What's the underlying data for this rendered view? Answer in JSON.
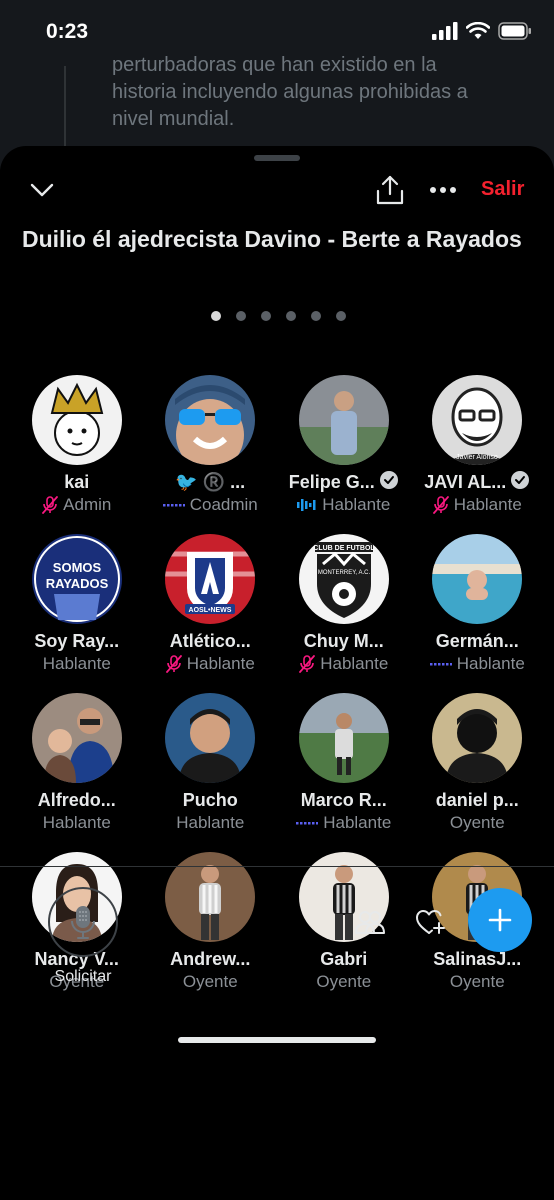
{
  "status": {
    "time": "0:23"
  },
  "background_tweet": {
    "line1": "perturbadoras que han existido en la",
    "line2": "historia incluyendo algunas prohibidas a",
    "line3": "nivel mundial."
  },
  "header": {
    "leave_label": "Salir"
  },
  "space": {
    "title": "Duilio él ajedrecista Davino - Berte a Rayados"
  },
  "pager": {
    "count": 6,
    "active": 0
  },
  "participants": [
    {
      "name": "kai",
      "role": "Admin",
      "status": "muted",
      "verified": false,
      "avatar": {
        "bg": "#f2f2f2",
        "fg": "#c9a227",
        "type": "crown"
      }
    },
    {
      "name": "🐦 ®️ ...",
      "role": "Coadmin",
      "status": "idle",
      "verified": false,
      "avatar": {
        "bg": "#d6a88a",
        "fg": "#1d9bf0",
        "type": "sunglasses"
      }
    },
    {
      "name": "Felipe G...",
      "role": "Hablante",
      "status": "speaking",
      "verified": true,
      "avatar": {
        "bg": "#5f7f5a",
        "fg": "#9bb2cf",
        "type": "stadium"
      }
    },
    {
      "name": "JAVI AL...",
      "role": "Hablante",
      "status": "muted",
      "verified": true,
      "avatar": {
        "bg": "#dcdcdc",
        "fg": "#222222",
        "type": "sketch",
        "caption": "Javier Alonso"
      }
    },
    {
      "name": "Soy Ray...",
      "role": "Hablante",
      "status": "none",
      "verified": false,
      "avatar": {
        "bg": "#1a2f7a",
        "fg": "#ffffff",
        "type": "text",
        "lines": [
          "SOMOS",
          "RAYADOS"
        ]
      }
    },
    {
      "name": "Atlético...",
      "role": "Hablante",
      "status": "muted",
      "verified": false,
      "avatar": {
        "bg": "#c8202c",
        "fg": "#ffffff",
        "type": "shield",
        "caption": "AOSL•NEWS"
      }
    },
    {
      "name": "Chuy M...",
      "role": "Hablante",
      "status": "muted",
      "verified": false,
      "avatar": {
        "bg": "#f4f4f4",
        "fg": "#1b1b1b",
        "type": "crest",
        "lines": [
          "CLUB DE FUTBOL",
          "MONTERREY, A.C."
        ]
      }
    },
    {
      "name": "Germán...",
      "role": "Hablante",
      "status": "idle",
      "verified": false,
      "avatar": {
        "bg": "#3fa6c9",
        "fg": "#e0b49b",
        "type": "pool"
      }
    },
    {
      "name": "Alfredo...",
      "role": "Hablante",
      "status": "none",
      "verified": false,
      "avatar": {
        "bg": "#9c8c80",
        "fg": "#1c3f8c",
        "type": "couple"
      }
    },
    {
      "name": "Pucho",
      "role": "Hablante",
      "status": "none",
      "verified": false,
      "avatar": {
        "bg": "#2a5a8a",
        "fg": "#d1a07f",
        "type": "selfie"
      }
    },
    {
      "name": "Marco R...",
      "role": "Hablante",
      "status": "idle",
      "verified": false,
      "avatar": {
        "bg": "#4f7a45",
        "fg": "#dcdcdc",
        "type": "field"
      }
    },
    {
      "name": "daniel p...",
      "role": "Oyente",
      "status": "none",
      "verified": false,
      "avatar": {
        "bg": "#c9b88f",
        "fg": "#111111",
        "type": "selfie"
      }
    },
    {
      "name": "Nancy V...",
      "role": "Oyente",
      "status": "none",
      "verified": false,
      "avatar": {
        "bg": "#f5f5f5",
        "fg": "#7a5a4a",
        "type": "portrait"
      }
    },
    {
      "name": "Andrew...",
      "role": "Oyente",
      "status": "none",
      "verified": false,
      "avatar": {
        "bg": "#7c5d45",
        "fg": "#cfcfcf",
        "type": "standing"
      }
    },
    {
      "name": "Gabri",
      "role": "Oyente",
      "status": "none",
      "verified": false,
      "avatar": {
        "bg": "#ece8e2",
        "fg": "#1a1a1a",
        "type": "standing"
      }
    },
    {
      "name": "SalinasJ...",
      "role": "Oyente",
      "status": "none",
      "verified": false,
      "avatar": {
        "bg": "#b08a4c",
        "fg": "#1a1a1a",
        "type": "standing"
      }
    }
  ],
  "footer": {
    "request_label": "Solicitar"
  },
  "colors": {
    "accent": "#1d9bf0",
    "leave": "#f4212e",
    "muted": "#f91880",
    "speaking": "#1d9bf0",
    "idle": "#5a5ff0"
  }
}
